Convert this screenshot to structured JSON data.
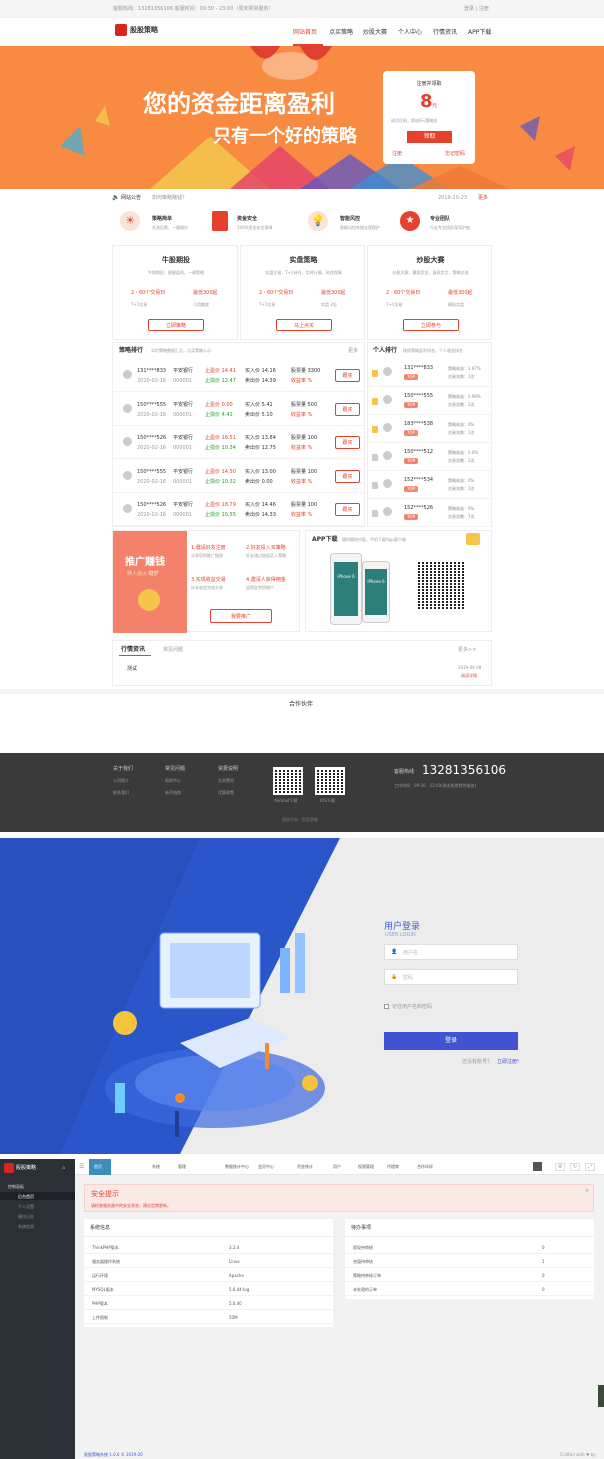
{
  "topbar": {
    "left": "客服热线：13281356106  客服时间：09:30 - 23:00（周末照常服务）",
    "right": "登录 | 注册"
  },
  "nav": {
    "logo": "股股策略",
    "items": [
      "网站首页",
      "点买策略",
      "炒股大赛",
      "个人中心",
      "行情资讯",
      "APP下载"
    ]
  },
  "banner": {
    "line1": "您的资金距离盈利",
    "line2": "只有一个好的策略",
    "box_title": "注册并领取",
    "box_num": "8",
    "box_unit": "元",
    "box_desc": "成功注册，即送8元策略金",
    "box_btn": "领取",
    "link_left": "注册",
    "link_right": "忘记密码"
  },
  "notice": {
    "label": "网站公告",
    "text": "如何策略赚钱？",
    "date": "2019-10-23",
    "more": "更多"
  },
  "features": [
    {
      "icon": "sun-icon",
      "title": "策略简单",
      "desc": "先涨后跌，一键操作"
    },
    {
      "icon": "door-icon",
      "title": "资金安全",
      "desc": "100%资金安全保障"
    },
    {
      "icon": "bulb-icon",
      "title": "智能风控",
      "desc": "智能风控系统全程保护"
    },
    {
      "icon": "medal-icon",
      "title": "专业团队",
      "desc": "行业专业团队保驾护航"
    }
  ],
  "products": [
    {
      "title": "牛股期投",
      "desc": "牛股期投，稳健盈利，一键策略",
      "a": "2 · 60个交易日",
      "b": "最低300起",
      "c": "T+1交易",
      "d": "可用额度",
      "btn": "立即策略"
    },
    {
      "title": "实盘策略",
      "desc": "实盘交易，T+1持仓，实时行情，风控保障",
      "a": "2 · 60个交易日",
      "b": "最低300起",
      "c": "T+1交易",
      "d": "实盘 2倍",
      "btn": "马上点买"
    },
    {
      "title": "炒股大赛",
      "desc": "炒股大赛，赢取奖金，展现实力，策略交流",
      "a": "2 · 60个交易日",
      "b": "最低300起",
      "c": "T+1交易",
      "d": "模拟实盘",
      "btn": "立即参与"
    }
  ],
  "ranking": {
    "title": "策略排行",
    "sub": "实时策略数据汇总，点买策略公示",
    "more": "更多",
    "rows": [
      {
        "user": "131****833",
        "date": "2020-02-16",
        "stock": "平安银行",
        "code": "000001",
        "win": "止盈价 14.41",
        "loss": "止损价 12.47",
        "buy": "买入价 14.16",
        "sell": "卖出价 14.39",
        "qty": "股票量 3300",
        "profit": "收益率 %",
        "btn": "跟买"
      },
      {
        "user": "150****555",
        "date": "2020-02-16",
        "stock": "平安银行",
        "code": "000001",
        "win": "止盈价 0.00",
        "loss": "止损价 4.41",
        "buy": "买入价 5.41",
        "sell": "卖出价 5.10",
        "qty": "股票量 500",
        "profit": "收益率 %",
        "btn": "跟买"
      },
      {
        "user": "150****526",
        "date": "2020-02-16",
        "stock": "平安银行",
        "code": "000001",
        "win": "止盈价 16.51",
        "loss": "止损价 10.34",
        "buy": "买入价 13.84",
        "sell": "卖出价 12.75",
        "qty": "股票量 100",
        "profit": "收益率 %",
        "btn": "跟买"
      },
      {
        "user": "150****555",
        "date": "2020-02-16",
        "stock": "平安银行",
        "code": "000001",
        "win": "止盈价 14.50",
        "loss": "止损价 10.32",
        "buy": "买入价 13.00",
        "sell": "卖出价 0.00",
        "qty": "股票量 100",
        "profit": "收益率 %",
        "btn": "跟买"
      },
      {
        "user": "150****526",
        "date": "2020-02-16",
        "stock": "平安银行",
        "code": "000001",
        "win": "止盈价 18.79",
        "loss": "止损价 10.55",
        "buy": "买入价 14.46",
        "sell": "卖出价 14.33",
        "qty": "股票量 100",
        "profit": "收益率 %",
        "btn": "跟买"
      }
    ]
  },
  "personal": {
    "title": "个人排行",
    "sub": "按照策略盈利排名，个人收益排名",
    "rows": [
      {
        "user": "131****833",
        "tag": "TOP",
        "a": "策略收益：1.67%",
        "b": "交易次数：1次"
      },
      {
        "user": "150****555",
        "tag": "TOP",
        "a": "策略收益：0.99%",
        "b": "交易次数：2次"
      },
      {
        "user": "183****538",
        "tag": "TOP",
        "a": "策略收益：0%",
        "b": "交易次数：1次"
      },
      {
        "user": "150****512",
        "tag": "TOP",
        "a": "策略收益：0.0%",
        "b": "交易次数：2次"
      },
      {
        "user": "152****534",
        "tag": "TOP",
        "a": "策略收益：0%",
        "b": "交易次数：3次"
      },
      {
        "user": "152****526",
        "tag": "TOP",
        "a": "策略收益：0%",
        "b": "交易次数：7次"
      }
    ]
  },
  "promo": {
    "title": "推广赚钱",
    "sub": "伴人点火·糖梦",
    "steps": [
      {
        "t": "1.邀请好友注册",
        "d": "分享您的推广链接"
      },
      {
        "t": "2.好友投入买策略",
        "d": "好友通过链接买入策略"
      },
      {
        "t": "3.实现收益交易",
        "d": "好友收益完成交易"
      },
      {
        "t": "4.邀请人获得佣金",
        "d": "返佣金到您账户"
      }
    ],
    "btn": "我要推广"
  },
  "app": {
    "title": "APP下载",
    "sub": "随时随地炒股，手机下载App客户端",
    "phone": "iPhone 6"
  },
  "news": {
    "tab1": "行情资讯",
    "tab2": "常见问题",
    "more": "更多>>",
    "item": "测试",
    "date": "2019-04-08",
    "link": "阅读详情"
  },
  "partners": "合作伙伴",
  "footer": {
    "cols": [
      [
        "关于我们",
        "公司简介",
        "联系我们"
      ],
      [
        "常见问题",
        "帮助中心",
        "新手指南"
      ],
      [
        "资费说明",
        "交易费用",
        "优惠政策"
      ]
    ],
    "qr1": "Android下载",
    "qr2": "IOS下载",
    "hotline_label": "客服热线",
    "phone": "13281356106",
    "hours": "工作时间：09:30 - 23:00(周末照常提供服务)",
    "copy": "版权所有 · 股股策略"
  },
  "login": {
    "title": "用户登录",
    "sub": "USER LOGIN",
    "user_ph": "用户名",
    "pass_ph": "密码",
    "remember": "记住用户名和密码",
    "btn": "登录",
    "reg_q": "还没有账号？",
    "reg": "立即注册!"
  },
  "admin": {
    "logo": "股股策略",
    "tabs": [
      "首页",
      "系统",
      "管理",
      "数据统计中心",
      "会员中心",
      "资金统计",
      "用户",
      "权限管理",
      "代理商",
      "合作伙伴"
    ],
    "side_title": "控制面板",
    "side_items": [
      "后台首页",
      "个人设置",
      "操作日志",
      "系统信息"
    ],
    "alert_title": "安全提示",
    "alert_text": "请检查服务器中的安全状态，建议定期更新。",
    "sys_title": "系统信息",
    "sys": [
      [
        "ThinkPHP版本",
        "3.2.4"
      ],
      [
        "服务器操作系统",
        "Linux"
      ],
      [
        "运行环境",
        "Apache"
      ],
      [
        "MYSQL版本",
        "5.6.44-log"
      ],
      [
        "PHP版本",
        "5.6.40"
      ],
      [
        "上传限制",
        "50M"
      ]
    ],
    "stat_title": "待办事项",
    "stats": [
      [
        "提现待审核",
        "0"
      ],
      [
        "充值待审核",
        "1"
      ],
      [
        "策略待审核订单",
        "0"
      ],
      [
        "未处理的订单",
        "0"
      ]
    ],
    "foot": "股股策略系统 1.0.0 © 2019-20",
    "foot_r": "Crafted with ♥ by"
  }
}
